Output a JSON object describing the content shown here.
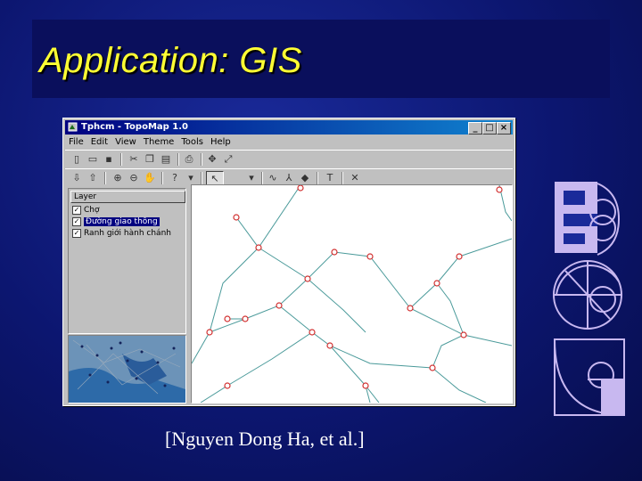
{
  "slide": {
    "title": "Application: GIS",
    "caption": "[Nguyen Dong Ha, et al.]"
  },
  "window": {
    "title": "Tphcm - TopoMap 1.0",
    "controls": [
      "_",
      "□",
      "×"
    ]
  },
  "menu": [
    "File",
    "Edit",
    "View",
    "Theme",
    "Tools",
    "Help"
  ],
  "layers": {
    "header": "Layer",
    "items": [
      {
        "label": "Chợ",
        "checked": true,
        "selected": false
      },
      {
        "label": "Đường giao thông",
        "checked": true,
        "selected": true
      },
      {
        "label": "Ranh giới hành chánh",
        "checked": true,
        "selected": false
      }
    ]
  },
  "colors": {
    "road": "#4a9a9a",
    "node": "#d23030",
    "slide_bg": "#0c1670",
    "title": "#ffff33"
  }
}
